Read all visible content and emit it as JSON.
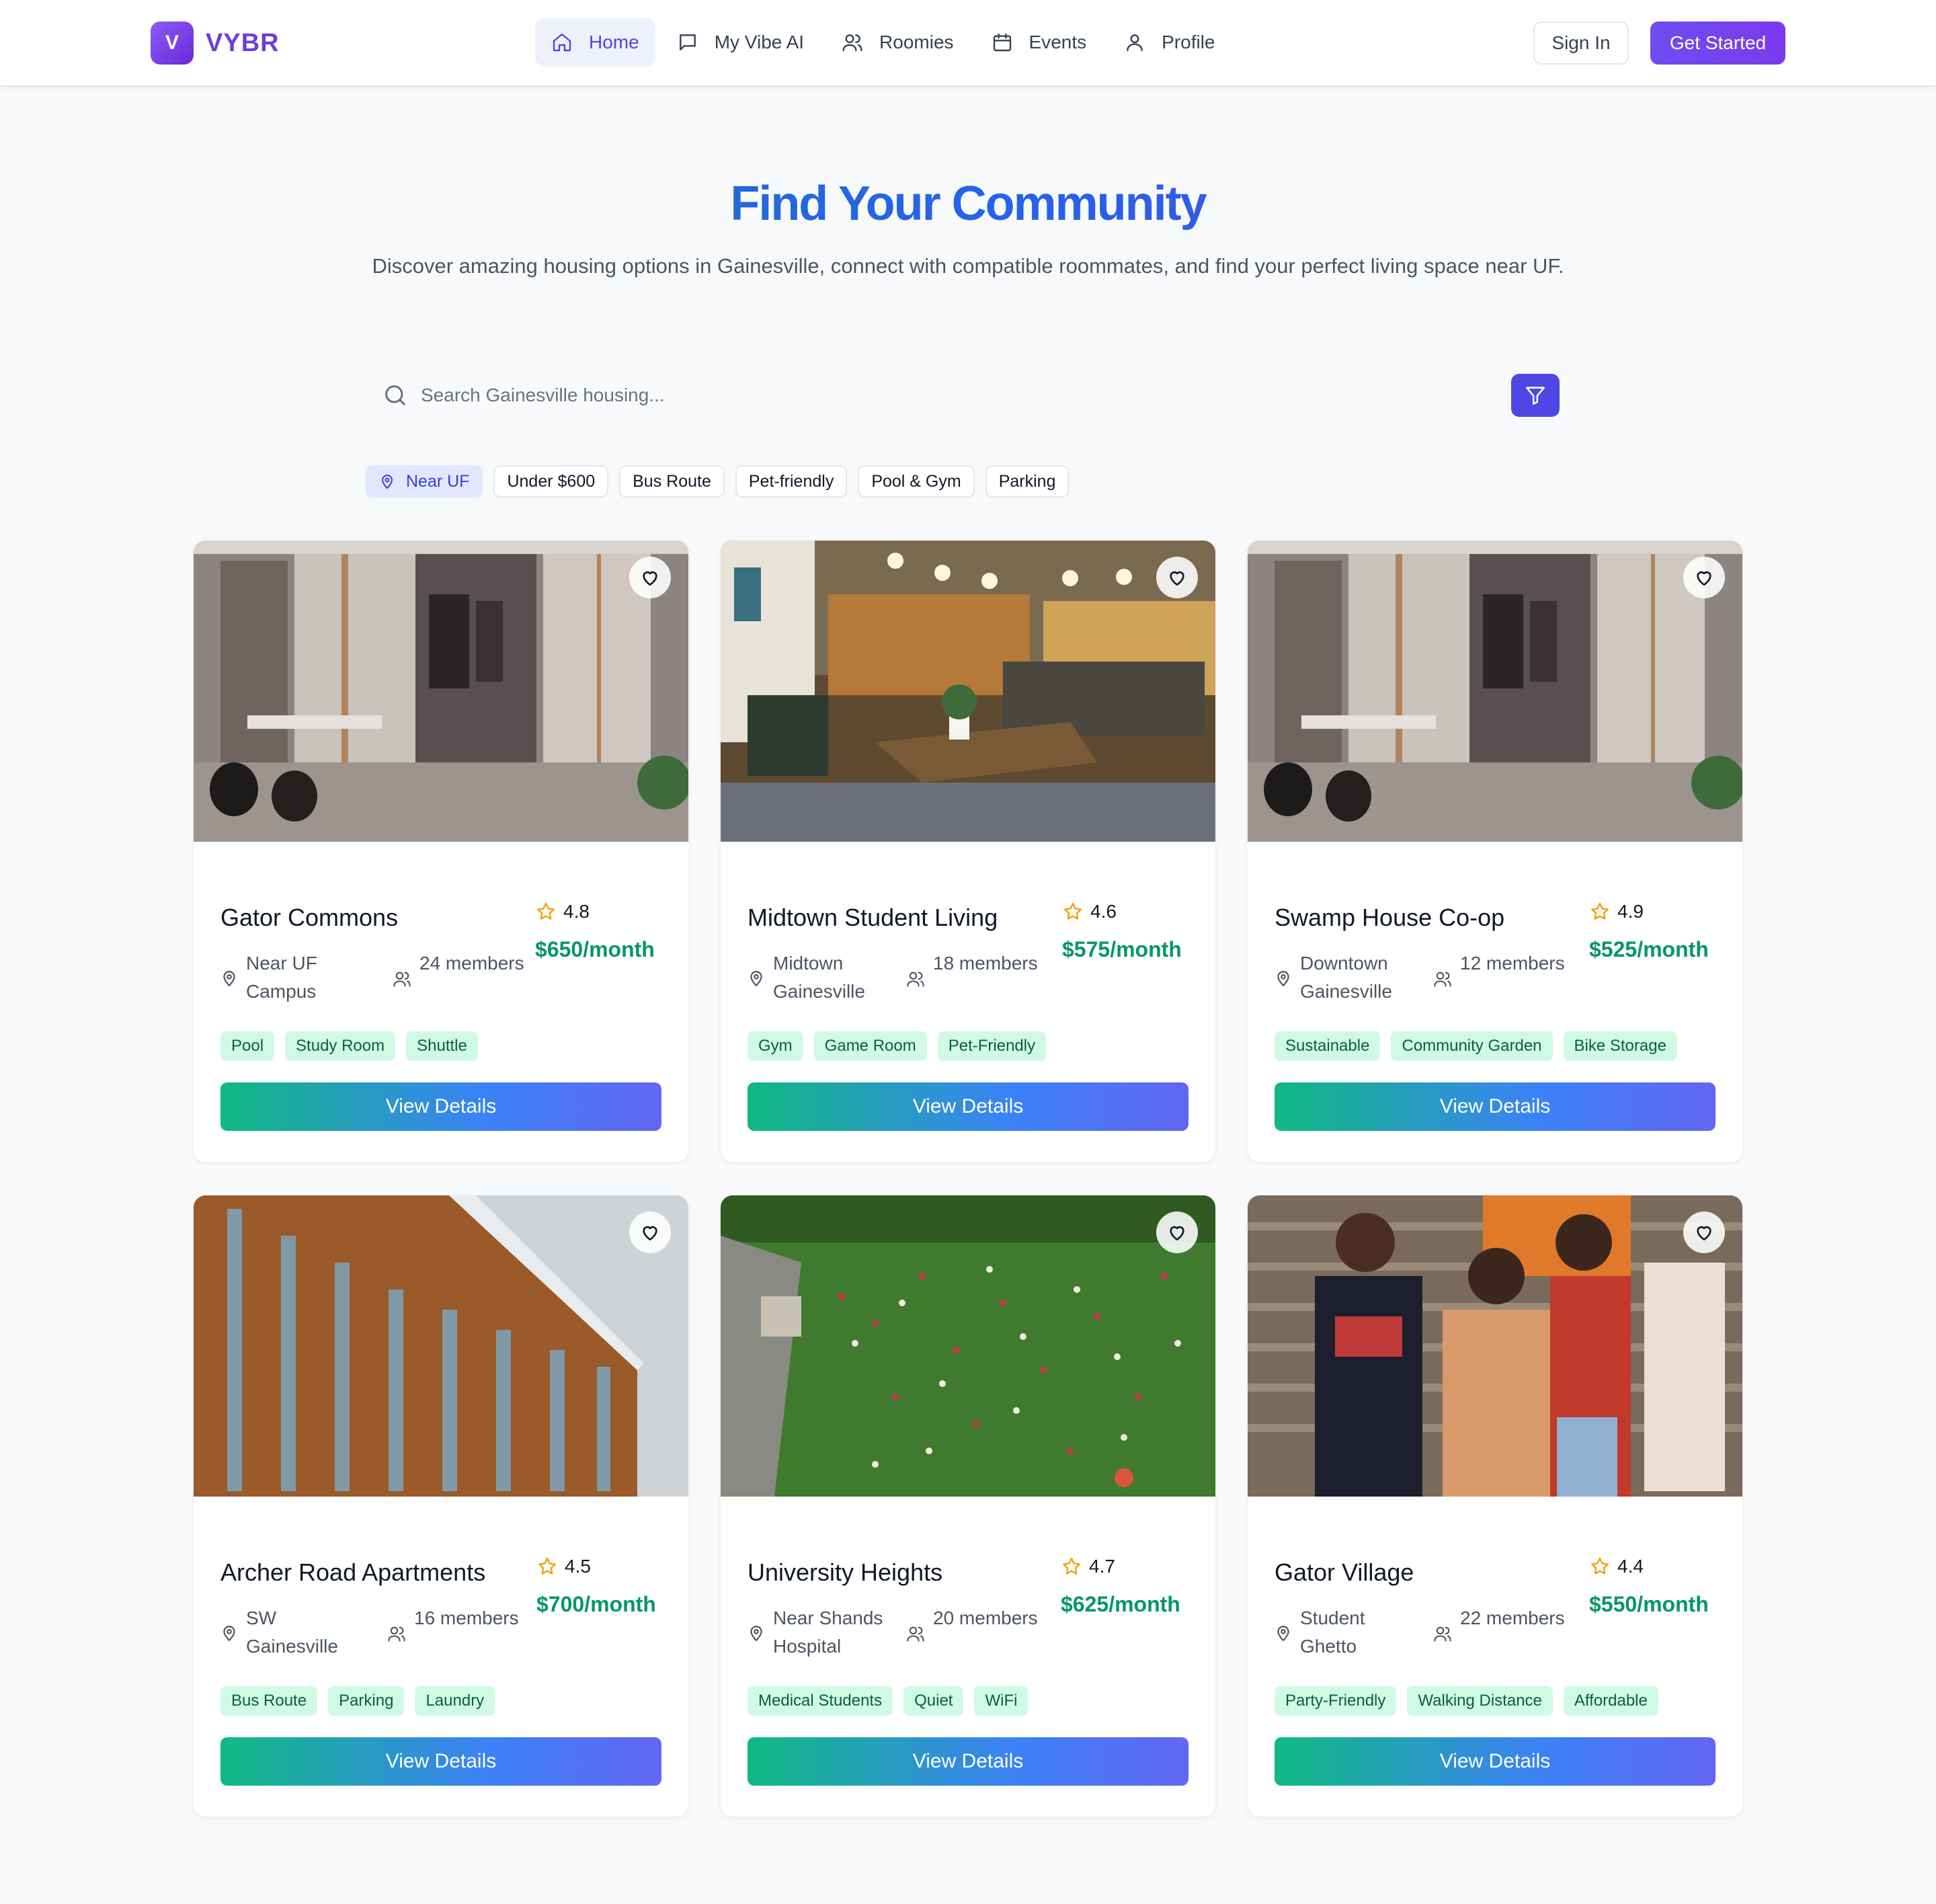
{
  "brand": {
    "badge": "V",
    "name": "VYBR",
    "color": "#6d3fd8"
  },
  "nav": {
    "items": [
      {
        "label": "Home",
        "icon": "home-icon",
        "active": true
      },
      {
        "label": "My Vibe AI",
        "icon": "chat-icon",
        "active": false
      },
      {
        "label": "Roomies",
        "icon": "users-icon",
        "active": false
      },
      {
        "label": "Events",
        "icon": "calendar-icon",
        "active": false
      },
      {
        "label": "Profile",
        "icon": "user-icon",
        "active": false
      }
    ],
    "sign_in": "Sign In",
    "get_started": "Get Started"
  },
  "hero": {
    "title": "Find Your Community",
    "subtitle": "Discover amazing housing options in Gainesville, connect with compatible roommates, and find your perfect living space near UF."
  },
  "search": {
    "placeholder": "Search Gainesville housing...",
    "filter_icon": "filter-icon"
  },
  "chips": [
    {
      "label": "Near UF",
      "active": true,
      "icon": "map-pin-icon"
    },
    {
      "label": "Under $600",
      "active": false
    },
    {
      "label": "Bus Route",
      "active": false
    },
    {
      "label": "Pet-friendly",
      "active": false
    },
    {
      "label": "Pool & Gym",
      "active": false
    },
    {
      "label": "Parking",
      "active": false
    }
  ],
  "listings": [
    {
      "name": "Gator Commons",
      "rating": "4.8",
      "price": "$650/month",
      "location": "Near UF Campus",
      "members": "24 members",
      "tags": [
        "Pool",
        "Study Room",
        "Shuttle"
      ],
      "image": "modern-closet-room-photo",
      "cta": "View Details"
    },
    {
      "name": "Midtown Student Living",
      "rating": "4.6",
      "price": "$575/month",
      "location": "Midtown Gainesville",
      "members": "18 members",
      "tags": [
        "Gym",
        "Game Room",
        "Pet-Friendly"
      ],
      "image": "lounge-interior-photo",
      "cta": "View Details"
    },
    {
      "name": "Swamp House Co-op",
      "rating": "4.9",
      "price": "$525/month",
      "location": "Downtown Gainesville",
      "members": "12 members",
      "tags": [
        "Sustainable",
        "Community Garden",
        "Bike Storage"
      ],
      "image": "modern-closet-room-photo",
      "cta": "View Details"
    },
    {
      "name": "Archer Road Apartments",
      "rating": "4.5",
      "price": "$700/month",
      "location": "SW Gainesville",
      "members": "16 members",
      "tags": [
        "Bus Route",
        "Parking",
        "Laundry"
      ],
      "image": "wood-building-facade-photo",
      "cta": "View Details"
    },
    {
      "name": "University Heights",
      "rating": "4.7",
      "price": "$625/month",
      "location": "Near Shands Hospital",
      "members": "20 members",
      "tags": [
        "Medical Students",
        "Quiet",
        "WiFi"
      ],
      "image": "crowd-on-lawn-photo",
      "cta": "View Details"
    },
    {
      "name": "Gator Village",
      "rating": "4.4",
      "price": "$550/month",
      "location": "Student Ghetto",
      "members": "22 members",
      "tags": [
        "Party-Friendly",
        "Walking Distance",
        "Affordable"
      ],
      "image": "students-group-photo",
      "cta": "View Details"
    }
  ],
  "colors": {
    "accent": "#4f46e5",
    "price": "#059669",
    "tag_bg": "#d1fae5",
    "tag_text": "#065f46",
    "star": "#f59e0b"
  }
}
